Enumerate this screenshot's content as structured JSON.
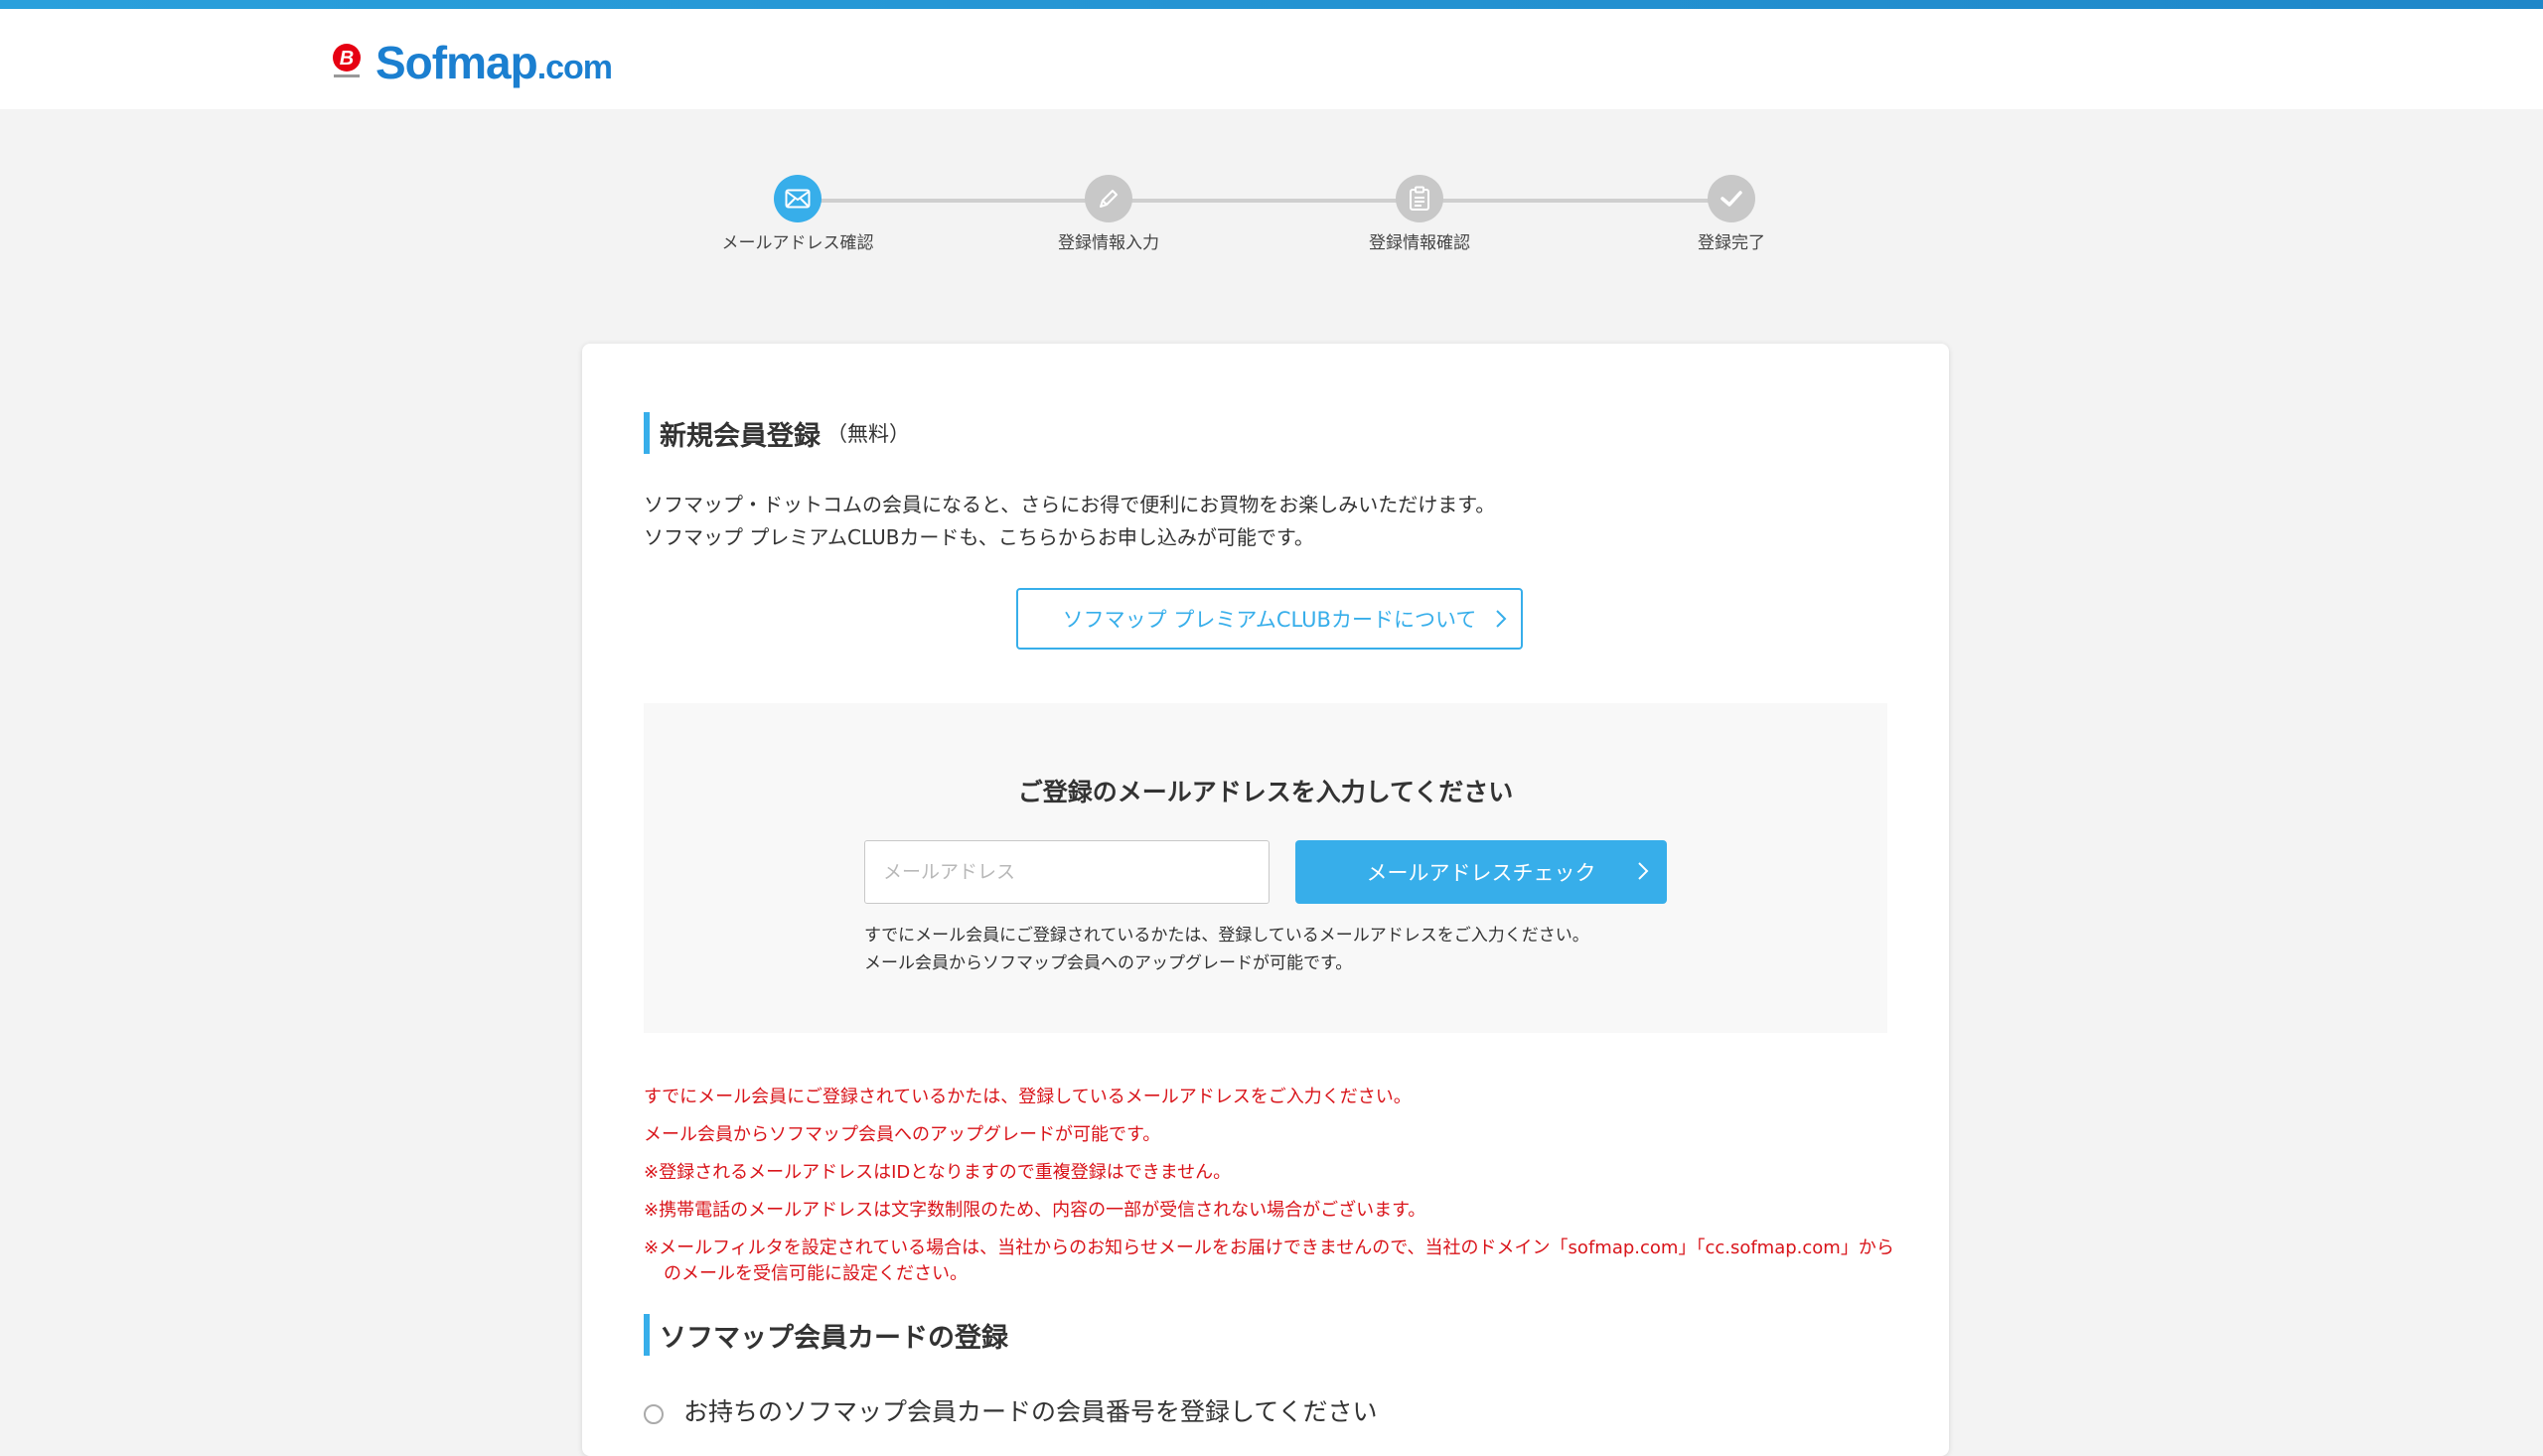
{
  "header": {
    "logo_text": "Sofmap",
    "logo_suffix": ".com"
  },
  "stepper": {
    "steps": [
      {
        "label": "メールアドレス確認",
        "icon": "mail-icon",
        "active": true
      },
      {
        "label": "登録情報入力",
        "icon": "pencil-icon",
        "active": false
      },
      {
        "label": "登録情報確認",
        "icon": "clipboard-icon",
        "active": false
      },
      {
        "label": "登録完了",
        "icon": "check-icon",
        "active": false
      }
    ]
  },
  "registration": {
    "title": "新規会員登録",
    "title_note": "（無料）",
    "intro_lines": [
      "ソフマップ・ドットコムの会員になると、さらにお得で便利にお買物をお楽しみいただけます。",
      "ソフマップ プレミアムCLUBカードも、こちらからお申し込みが可能です。"
    ],
    "card_info_button": "ソフマップ プレミアムCLUBカードについて"
  },
  "email_form": {
    "heading": "ご登録のメールアドレスを入力してください",
    "input_placeholder": "メールアドレス",
    "input_value": "",
    "check_button": "メールアドレスチェック",
    "note_lines": [
      "すでにメール会員にご登録されているかたは、登録しているメールアドレスをご入力ください。",
      "メール会員からソフマップ会員へのアップグレードが可能です。"
    ]
  },
  "notices": {
    "lines": [
      "すでにメール会員にご登録されているかたは、登録しているメールアドレスをご入力ください。",
      "メール会員からソフマップ会員へのアップグレードが可能です。",
      "※登録されるメールアドレスはIDとなりますので重複登録はできません。",
      "※携帯電話のメールアドレスは文字数制限のため、内容の一部が受信されない場合がございます。"
    ],
    "filter_line_1": "※メールフィルタを設定されている場合は、当社からのお知らせメールをお届けできませんので、当社のドメイン「sofmap.com」「cc.sofmap.com」から",
    "filter_line_2": "のメールを受信可能に設定ください。"
  },
  "member_card": {
    "title": "ソフマップ会員カードの登録",
    "radio_option": "お持ちのソフマップ会員カードの会員番号を登録してください"
  },
  "colors": {
    "accent": "#37aeea",
    "brand": "#1b7fd0",
    "notice": "#d9141a"
  }
}
